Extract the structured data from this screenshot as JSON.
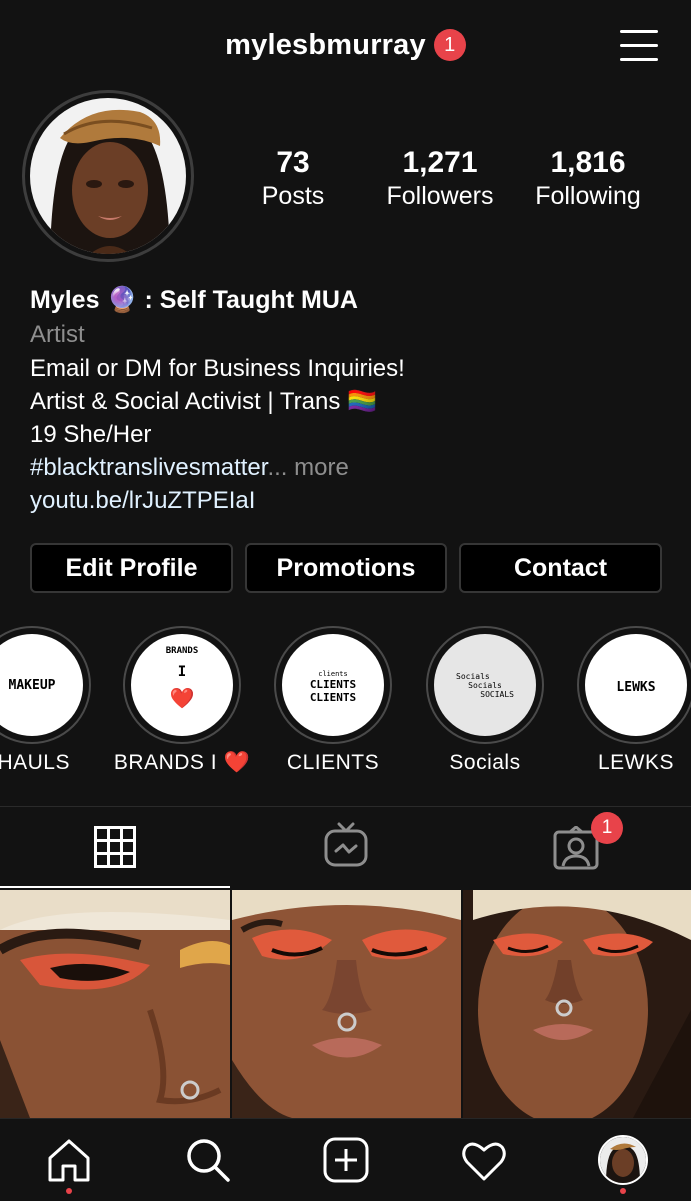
{
  "header": {
    "username": "mylesbmurray",
    "notification_count": "1",
    "menu_icon": "hamburger-menu-icon"
  },
  "profile": {
    "stats": [
      {
        "value": "73",
        "label": "Posts"
      },
      {
        "value": "1,271",
        "label": "Followers"
      },
      {
        "value": "1,816",
        "label": "Following"
      }
    ],
    "display_name": "Myles",
    "display_name_emoji": "🔮",
    "display_name_suffix": ": Self Taught MUA",
    "category": "Artist",
    "bio_lines": [
      "Email or DM for Business Inquiries!",
      "Artist & Social Activist | Trans",
      "19 She/Her"
    ],
    "bio_flag": "🏳️‍🌈",
    "hashtag": "#blacktranslivesmatter",
    "more_label": "... more",
    "link": "youtu.be/lrJuZTPEIaI"
  },
  "actions": {
    "edit_profile": "Edit Profile",
    "promotions": "Promotions",
    "contact": "Contact"
  },
  "highlights": [
    {
      "label": "HAULS",
      "cover_text": "MAKEUP"
    },
    {
      "label": "BRANDS I",
      "label_emoji": "❤️",
      "cover_lines": [
        "BRANDS",
        "I"
      ],
      "cover_emoji": "❤️"
    },
    {
      "label": "CLIENTS",
      "cover_lines": [
        "clients",
        "CLIENTS",
        "CLIENTS"
      ]
    },
    {
      "label": "Socials",
      "cover_lines": [
        "Socials",
        "Socials",
        "SOCIALS"
      ]
    },
    {
      "label": "LEWKS",
      "cover_text": "LEWKS"
    }
  ],
  "tabs": {
    "items": [
      "grid-icon",
      "igtv-icon",
      "tagged-icon"
    ],
    "tagged_badge": "1"
  },
  "bottom_nav": [
    "home-icon",
    "search-icon",
    "new-post-icon",
    "activity-heart-icon",
    "profile-avatar"
  ],
  "colors": {
    "background": "#121212",
    "badge": "#e8434a",
    "secondary_text": "#8e8e8e",
    "link": "#e0f1ff"
  }
}
